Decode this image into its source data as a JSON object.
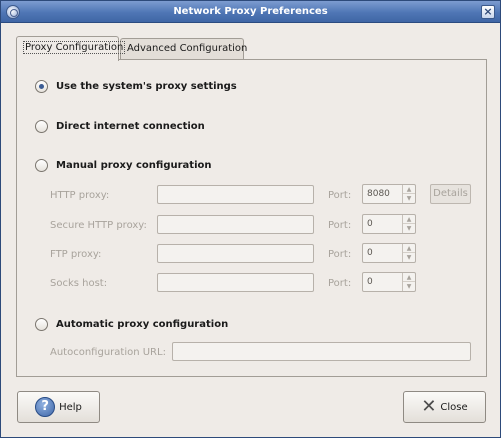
{
  "window": {
    "title": "Network Proxy Preferences"
  },
  "tabs": [
    {
      "label": "Proxy Configuration",
      "active": true
    },
    {
      "label": "Advanced Configuration",
      "active": false
    }
  ],
  "options": {
    "system": {
      "label": "Use the system's proxy settings",
      "checked": true
    },
    "direct": {
      "label": "Direct internet connection",
      "checked": false
    },
    "manual": {
      "label": "Manual proxy configuration",
      "checked": false
    },
    "auto": {
      "label": "Automatic proxy configuration",
      "checked": false
    }
  },
  "manual_fields": {
    "port_label": "Port:",
    "http": {
      "label": "HTTP proxy:",
      "value": "",
      "port": "8080"
    },
    "secure": {
      "label": "Secure HTTP proxy:",
      "value": "",
      "port": "0"
    },
    "ftp": {
      "label": "FTP proxy:",
      "value": "",
      "port": "0"
    },
    "socks": {
      "label": "Socks host:",
      "value": "",
      "port": "0"
    },
    "details_label": "Details"
  },
  "auto_fields": {
    "url_label": "Autoconfiguration URL:",
    "url_value": ""
  },
  "buttons": {
    "help": "Help",
    "close": "Close"
  },
  "icons": {
    "help": "help-icon",
    "close": "close-icon",
    "app": "network-proxy-icon"
  },
  "colors": {
    "titlebar": "#4f76b5",
    "window_bg": "#efebe7",
    "radio_dot": "#3b5c94"
  }
}
